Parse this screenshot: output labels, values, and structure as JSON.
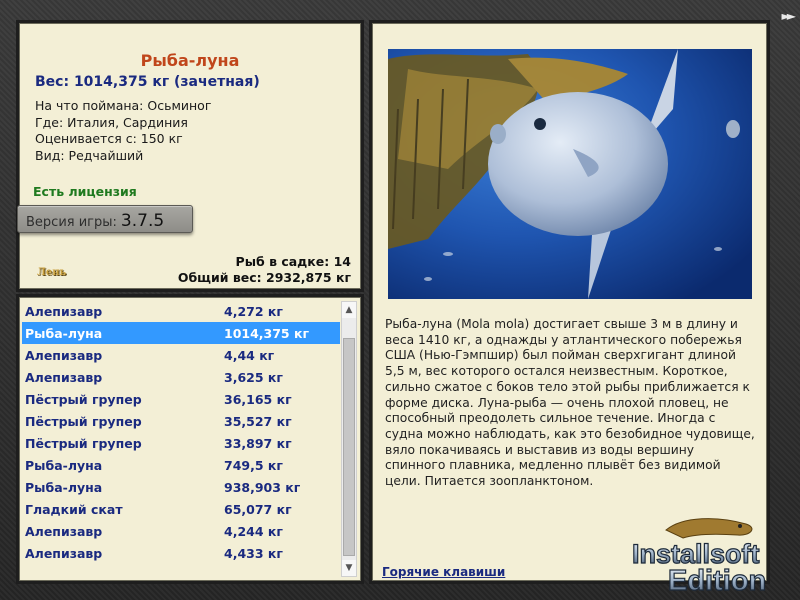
{
  "fish": {
    "name": "Рыба-луна",
    "weight_line": "Вес: 1014,375 кг (зачетная)",
    "details": [
      "На что поймана: Осьминог",
      "Где: Италия, Сардиния",
      "Оценивается с: 150 кг",
      "Вид: Редчайший"
    ]
  },
  "license": "Есть лицензия",
  "version": {
    "label": "Версия игры:",
    "number": "3.7.5"
  },
  "logo_text": "Лень",
  "totals": {
    "in_cage": "Рыб в садке: 14",
    "total_weight": "Общий вес: 2932,875 кг"
  },
  "catch_list": [
    {
      "name": "Алепизавр",
      "weight": "4,272 кг"
    },
    {
      "name": "Рыба-луна",
      "weight": "1014,375 кг",
      "selected": true
    },
    {
      "name": "Алепизавр",
      "weight": "4,44 кг"
    },
    {
      "name": "Алепизавр",
      "weight": "3,625 кг"
    },
    {
      "name": "Пёстрый групер",
      "weight": "36,165 кг"
    },
    {
      "name": "Пёстрый групер",
      "weight": "35,527 кг"
    },
    {
      "name": "Пёстрый групер",
      "weight": "33,897 кг"
    },
    {
      "name": "Рыба-луна",
      "weight": "749,5 кг"
    },
    {
      "name": "Рыба-луна",
      "weight": "938,903 кг"
    },
    {
      "name": "Гладкий скат",
      "weight": "65,077 кг"
    },
    {
      "name": "Алепизавр",
      "weight": "4,244 кг"
    },
    {
      "name": "Алепизавр",
      "weight": "4,433 кг"
    }
  ],
  "description": "Рыба-луна (Mola mola) достигает свыше 3 м в длину и веса 1410 кг, а однажды у атлантического побережья США (Нью-Гэмпшир) был пойман сверхгигант длиной 5,5 м, вес которого остался неизвестным. Короткое, сильно сжатое с боков тело этой рыбы приближается к форме диска. Луна-рыба — очень плохой пловец, не способный преодолеть сильное течение. Иногда с судна можно наблюдать, как это безобидное чудовище, вяло покачиваясь и выставив из воды вершину спинного плавника, медленно плывёт без видимой цели. Питается зоопланктоном.",
  "hotkeys_link": "Горячие клавиши",
  "watermark": {
    "line1": "Installsoft",
    "line2": "Edition"
  },
  "icons": {
    "forward": "fast-forward-icon",
    "scroll_up": "scroll-up-icon",
    "scroll_down": "scroll-down-icon"
  },
  "colors": {
    "fish_name": "#c0461b",
    "weight_blue": "#1a2a80",
    "license_green": "#1f7a1f",
    "selection": "#3399ff",
    "panel_bg": "#f3efd6"
  }
}
